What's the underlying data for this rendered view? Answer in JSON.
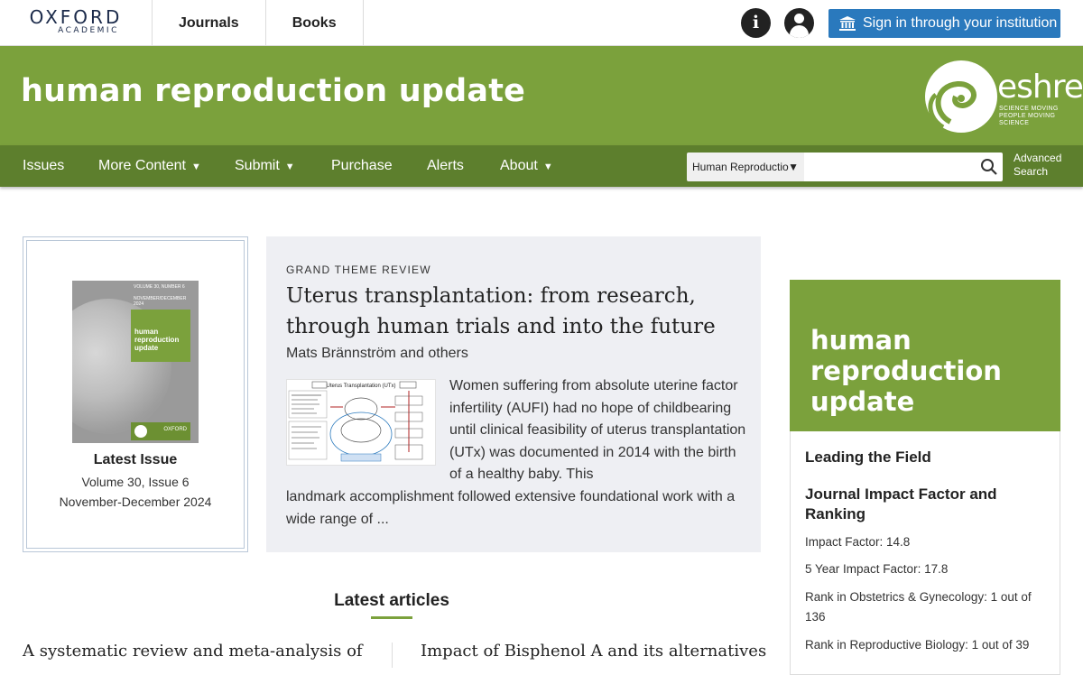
{
  "topbar": {
    "logo_line1": "OXFORD",
    "logo_line2": "ACADEMIC",
    "nav": [
      "Journals",
      "Books"
    ],
    "info_icon": "info-icon",
    "account_icon": "user-icon",
    "signin_label": "Sign in through your institution",
    "signin_icon": "institution-icon",
    "signin_color": "#2a79bd"
  },
  "banner": {
    "journal_title": "human reproduction update",
    "partner_logo_word": "eshre",
    "partner_tagline": "SCIENCE MOVING PEOPLE MOVING SCIENCE",
    "color": "#7ba13c"
  },
  "secnav": {
    "items": [
      {
        "label": "Issues",
        "dropdown": false
      },
      {
        "label": "More Content",
        "dropdown": true
      },
      {
        "label": "Submit",
        "dropdown": true
      },
      {
        "label": "Purchase",
        "dropdown": false
      },
      {
        "label": "Alerts",
        "dropdown": false
      },
      {
        "label": "About",
        "dropdown": true
      }
    ],
    "dropdown_caret": "▼",
    "search_scope": "Human Reproductio",
    "search_value": "",
    "search_icon": "search-icon",
    "advanced_search_line1": "Advanced",
    "advanced_search_line2": "Search",
    "color": "#5d7f2d"
  },
  "latest_issue": {
    "cover_vol_line1": "VOLUME 30, NUMBER 6",
    "cover_vol_line2": "NOVEMBER/DECEMBER 2024",
    "cover_title_line1": "human",
    "cover_title_line2": "reproduction",
    "cover_title_line3": "update",
    "cover_footer_text": "OXFORD",
    "title": "Latest Issue",
    "volume": "Volume 30, Issue 6",
    "date": "November-December 2024"
  },
  "feature": {
    "kicker": "GRAND THEME REVIEW",
    "title": "Uterus transplantation: from research, through human trials and into the future",
    "authors": "Mats Brännström and others",
    "figure_title": "Uterus Transplantation (UTx)",
    "abstract_part1": "Women suffering from absolute uterine factor infertility (AUFI) had no hope of childbearing until clinical feasibility of uterus transplantation (UTx) was documented in 2014 with the birth of a healthy baby. This",
    "abstract_part2": "landmark accomplishment followed extensive foundational work with a wide range of ..."
  },
  "latest_articles": {
    "heading": "Latest articles",
    "items": [
      "A systematic review and meta-analysis of",
      "Impact of Bisphenol A and its alternatives"
    ]
  },
  "sidebar": {
    "journal_title_line1": "human",
    "journal_title_line2": "reproduction",
    "journal_title_line3": "update",
    "section_title": "Leading the Field",
    "metrics_heading": "Journal Impact Factor and Ranking",
    "metrics": [
      "Impact Factor: 14.8",
      "5 Year Impact Factor: 17.8",
      "Rank in Obstetrics & Gynecology: 1 out of 136",
      "Rank in Reproductive Biology: 1 out of 39"
    ]
  }
}
